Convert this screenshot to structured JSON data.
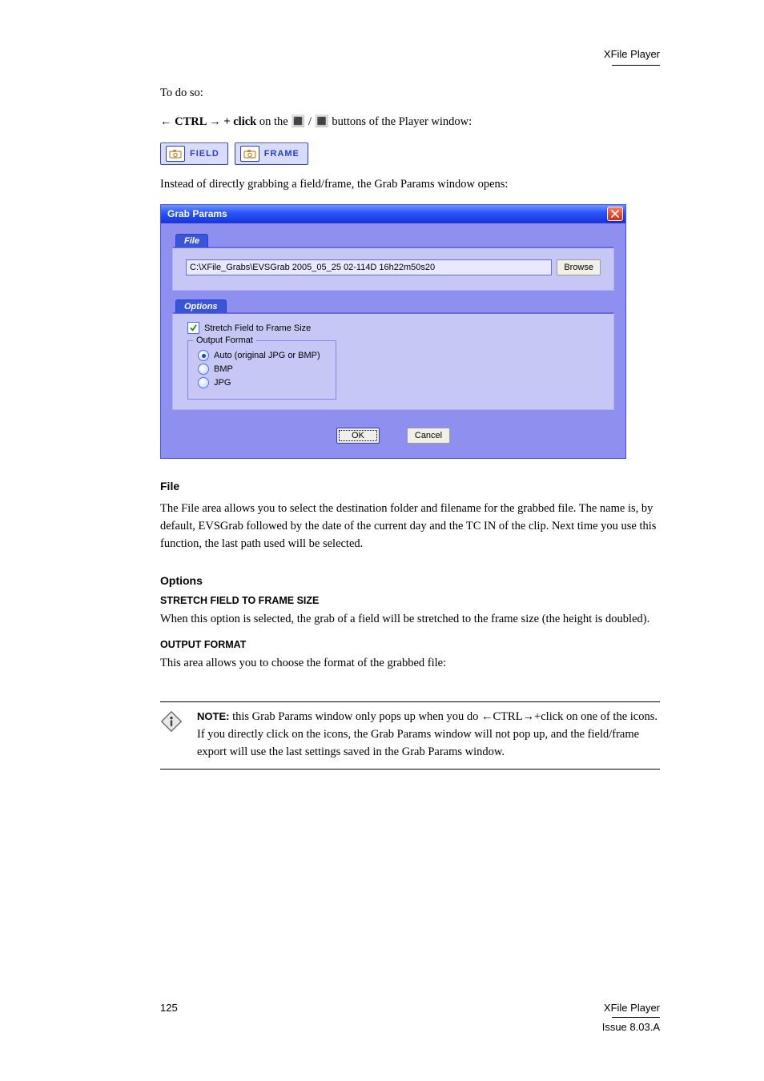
{
  "header": {
    "breadcrumb": "XFile Player"
  },
  "para": {
    "intro1": "To do so:",
    "intro2a": " on the ",
    "intro2b": " / ",
    "intro2c": " buttons of the Player window:",
    "ctrl_click": "← CTRL → + click",
    "field_label": "FIELD",
    "frame_label": "FRAME",
    "after_buttons": "Instead of directly grabbing a field/frame, the Grab Params window opens:",
    "file_text": "The File area allows you to select the destination folder and filename for the grabbed file. The name is, by default, EVSGrab followed by the date of the current day and the TC IN of the clip. Next time you use this function, the last path used will be selected.",
    "note_lead": "NOTE:",
    "note_text": " this Grab Params window only pops up when you do ←CTRL→+click on one of the  icons. If you directly click on the icons, the Grab Params window will not pop up, and the field/frame export will use the last settings saved in the Grab Params window."
  },
  "h3": {
    "file": "File",
    "options": "Options",
    "stretch": "STRETCH FIELD TO FRAME SIZE",
    "stretch_body": "When this option is selected, the grab of a field will be stretched to the frame size (the height is doubled).",
    "output": "OUTPUT FORMAT",
    "output_body": "This area allows you to choose the format of the grabbed file:"
  },
  "dialog": {
    "title": "Grab Params",
    "file_tab": "File",
    "file_value": "C:\\XFile_Grabs\\EVSGrab 2005_05_25 02-114D 16h22m50s20",
    "browse": "Browse",
    "options_tab": "Options",
    "stretch_label": "Stretch Field to Frame Size",
    "group_legend": "Output Format",
    "radios": {
      "auto": "Auto (original JPG or BMP)",
      "bmp": "BMP",
      "jpg": "JPG"
    },
    "ok": "OK",
    "cancel": "Cancel"
  },
  "footer": {
    "left": "125",
    "right_top": "XFile Player",
    "right_bottom": "Issue 8.03.A"
  }
}
